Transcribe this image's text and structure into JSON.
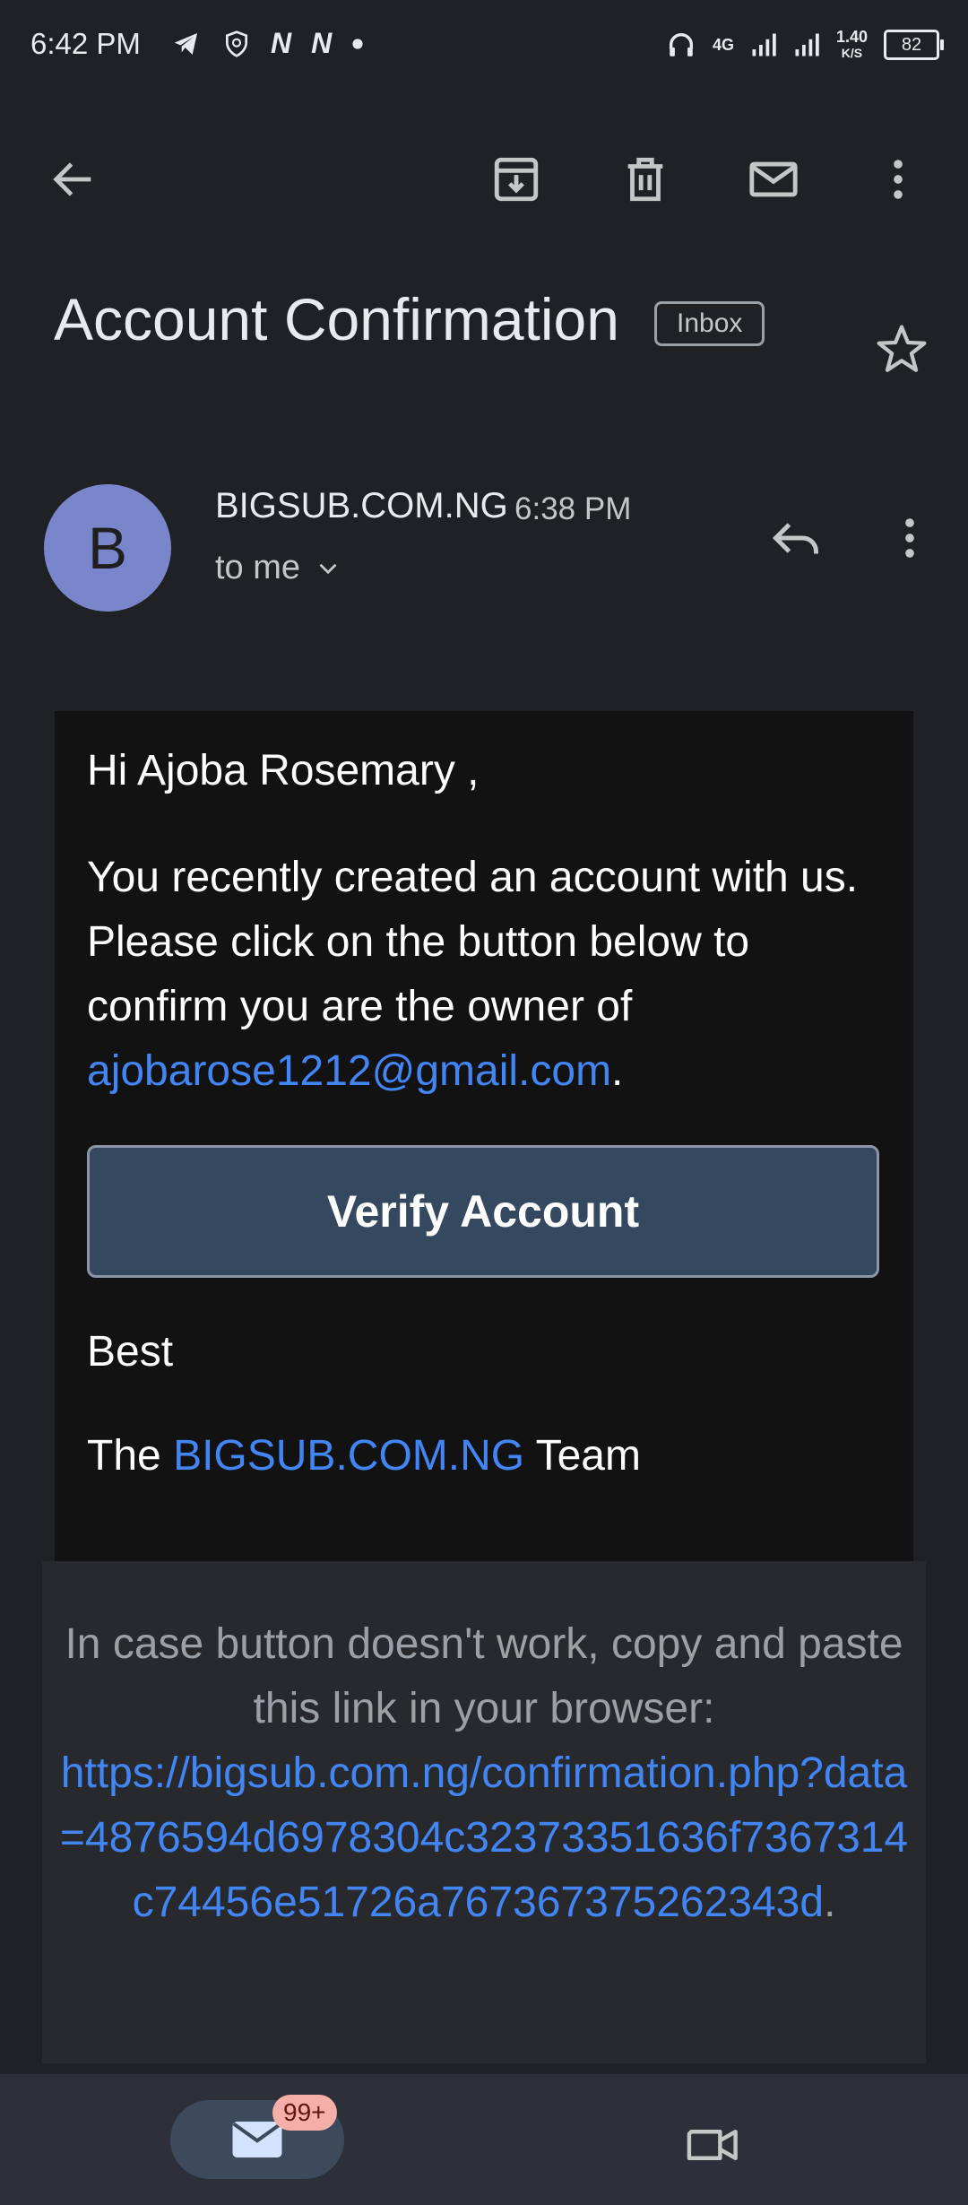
{
  "status_bar": {
    "time": "6:42 PM",
    "network_type": "4G",
    "speed_value": "1.40",
    "speed_unit": "K/S",
    "battery": "82",
    "notification_icons": [
      "telegram-icon",
      "shield-icon",
      "n-icon",
      "n-icon",
      "dot-icon"
    ]
  },
  "toolbar": {
    "icons": [
      "back-arrow-icon",
      "archive-icon",
      "delete-icon",
      "mark-unread-icon",
      "more-vert-icon"
    ]
  },
  "email": {
    "subject": "Account Confirmation",
    "label": "Inbox",
    "sender": {
      "initial": "B",
      "name": "BIGSUB.COM.NG",
      "time": "6:38 PM",
      "recipient": "to me"
    },
    "body": {
      "greeting": "Hi Ajoba Rosemary ,",
      "message_text": "You recently created an account with us. Please click on the button below to confirm you are the owner of",
      "email_link": "ajobarose1212@gmail.com",
      "period": ".",
      "button_label": "Verify Account",
      "signoff": "Best",
      "team_prefix": "The",
      "team_link": "BIGSUB.COM.NG",
      "team_suffix": "Team"
    },
    "footer": {
      "instruction": "In case button doesn't work, copy and paste this link in your browser:",
      "url": "https://bigsub.com.ng/confirmation.php?data=4876594d6978304c32373351636f7367314c74456e51726a767367375262343d",
      "period": "."
    }
  },
  "bottom_nav": {
    "mail_badge": "99+"
  },
  "colors": {
    "background": "#202124",
    "email_body": "#121212",
    "link": "#4285f4",
    "avatar": "#7986cb",
    "button": "#344860"
  }
}
